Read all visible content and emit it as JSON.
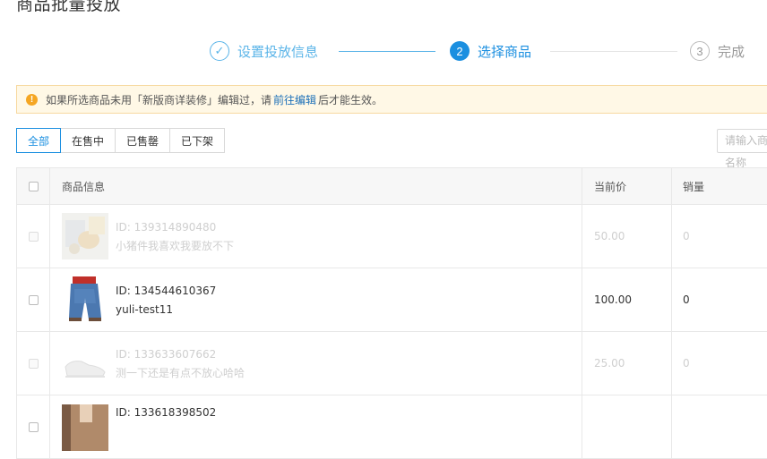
{
  "page": {
    "title": "商品批量投放"
  },
  "steps": [
    {
      "number": "✓",
      "label": "设置投放信息",
      "state": "done"
    },
    {
      "number": "2",
      "label": "选择商品",
      "state": "active"
    },
    {
      "number": "3",
      "label": "完成",
      "state": "wait"
    }
  ],
  "alert": {
    "icon": "!",
    "text_before": "如果所选商品未用「新版商详装修」编辑过，请",
    "link": "前往编辑",
    "text_after": "后才能生效。"
  },
  "filters": {
    "tabs": [
      "全部",
      "在售中",
      "已售罄",
      "已下架"
    ],
    "active_index": 0
  },
  "search": {
    "placeholder": "请输入商品名称"
  },
  "table": {
    "headers": {
      "info": "商品信息",
      "price": "当前价",
      "sales": "销量"
    },
    "rows": [
      {
        "id": "ID: 139314890480",
        "name": "小猪件我喜欢我要放不下",
        "price": "50.00",
        "sales": "0",
        "disabled": true,
        "thumb": "photo-icon"
      },
      {
        "id": "ID: 134544610367",
        "name": "yuli-test11",
        "price": "100.00",
        "sales": "0",
        "disabled": false,
        "thumb": "shorts-icon"
      },
      {
        "id": "ID: 133633607662",
        "name": "测一下还是有点不放心哈哈",
        "price": "25.00",
        "sales": "0",
        "disabled": true,
        "thumb": "sneaker-icon"
      },
      {
        "id": "ID: 133618398502",
        "name": "",
        "price": "",
        "sales": "",
        "disabled": false,
        "thumb": "photo-icon"
      }
    ]
  },
  "colors": {
    "primary": "#1b8fe0",
    "warning": "#f5a623",
    "alert_bg": "#fff8e6"
  }
}
